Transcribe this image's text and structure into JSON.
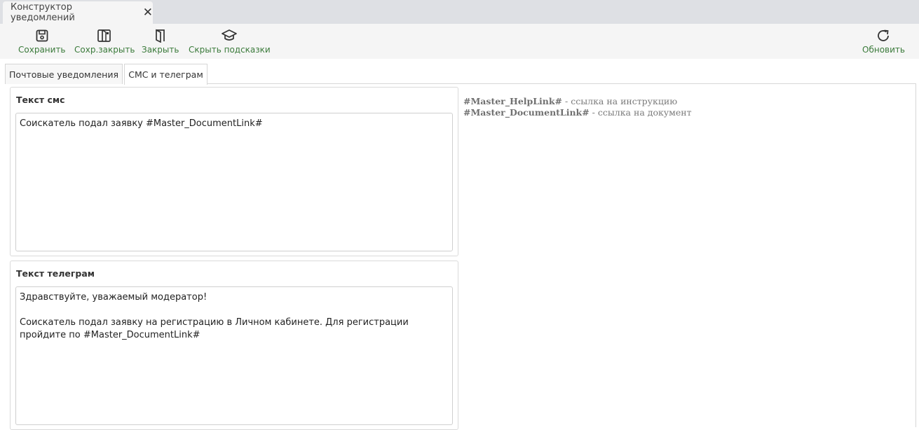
{
  "window": {
    "tab_title": "Конструктор уведомлений",
    "close_glyph": "✕"
  },
  "toolbar": {
    "save": {
      "label": "Сохранить",
      "icon": "save-icon"
    },
    "save_close": {
      "label": "Сохр.закрыть",
      "icon": "save-close-icon"
    },
    "close": {
      "label": "Закрыть",
      "icon": "door-icon"
    },
    "hide_hints": {
      "label": "Скрыть подсказки",
      "icon": "graduation-cap-icon"
    },
    "refresh": {
      "label": "Обновить",
      "icon": "refresh-icon"
    },
    "accent_color": "#3a7a3a"
  },
  "tabs": [
    {
      "label": "Почтовые уведомления",
      "active": false
    },
    {
      "label": "СМС и телеграм",
      "active": true
    }
  ],
  "sms": {
    "title": "Текст смс",
    "value": "Соискатель подал заявку #Master_DocumentLink#"
  },
  "telegram": {
    "title": "Текст телеграм",
    "value": "Здравствуйте, уважаемый модератор!\n\nСоискатель подал заявку на регистрацию в Личном кабинете. Для регистрации пройдите по #Master_DocumentLink#"
  },
  "hints": [
    {
      "key": "#Master_HelpLink#",
      "desc": " - ссылка на инструкцию"
    },
    {
      "key": "#Master_DocumentLink#",
      "desc": " - ссылка на документ"
    }
  ]
}
